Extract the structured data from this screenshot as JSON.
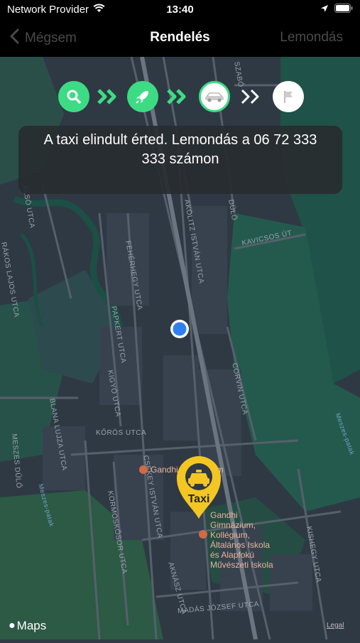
{
  "status_bar": {
    "carrier": "Network Provider",
    "time": "13:40"
  },
  "nav": {
    "back_label": "Mégsem",
    "title": "Rendelés",
    "right_label": "Lemondás"
  },
  "banner": {
    "line1": "A taxi elindult érted. Lemondás a 06 72 333",
    "line2": "333 számon"
  },
  "steps": [
    {
      "icon": "search-icon",
      "state": "done"
    },
    {
      "icon": "rocket-icon",
      "state": "done"
    },
    {
      "icon": "car-icon",
      "state": "active"
    },
    {
      "icon": "flag-icon",
      "state": "pending"
    }
  ],
  "colors": {
    "accent": "#3ddc84",
    "pin": "#f3c623",
    "user_dot": "#2f7ff0"
  },
  "map": {
    "street_labels": {
      "a": "RÁKOS LAJOS UTCA",
      "b": "ALSÓ UTCA",
      "c": "FEHÉRHEGY UTCA",
      "d": "PAPKERT UTCA",
      "e": "KIGYÓ UTCA",
      "f": "KŐRÖS UTCA",
      "g": "KORMOSKŐSOR UTCA",
      "h": "CSEKEY ISTVÁN UTCA",
      "i": "AKNÁSZ UTCA",
      "j": "MADÁS JÓZSEF UTCA",
      "k": "KAVICSOS ÚT",
      "l": "CORVIN UTCA",
      "m": "KISHEGY UTCA",
      "n": "BLANA LUJZA UTCA",
      "o": "MESZES DŰLŐ",
      "p": "DÜLÖ",
      "q": "Meszes-patak",
      "r": "AKOLITZ ISTVÁN UTCA",
      "s": "SZABÓ"
    },
    "poi1": "Gandhi Gimnázium",
    "poi2_lines": [
      "Gandhi",
      "Gimnázium,",
      "Kollégium,",
      "Általános Iskola",
      "és Alapfokú",
      "Művészeti Iskola"
    ]
  },
  "pin": {
    "label": "Taxi"
  },
  "footer": {
    "maps": "Maps",
    "legal": "Legal"
  }
}
